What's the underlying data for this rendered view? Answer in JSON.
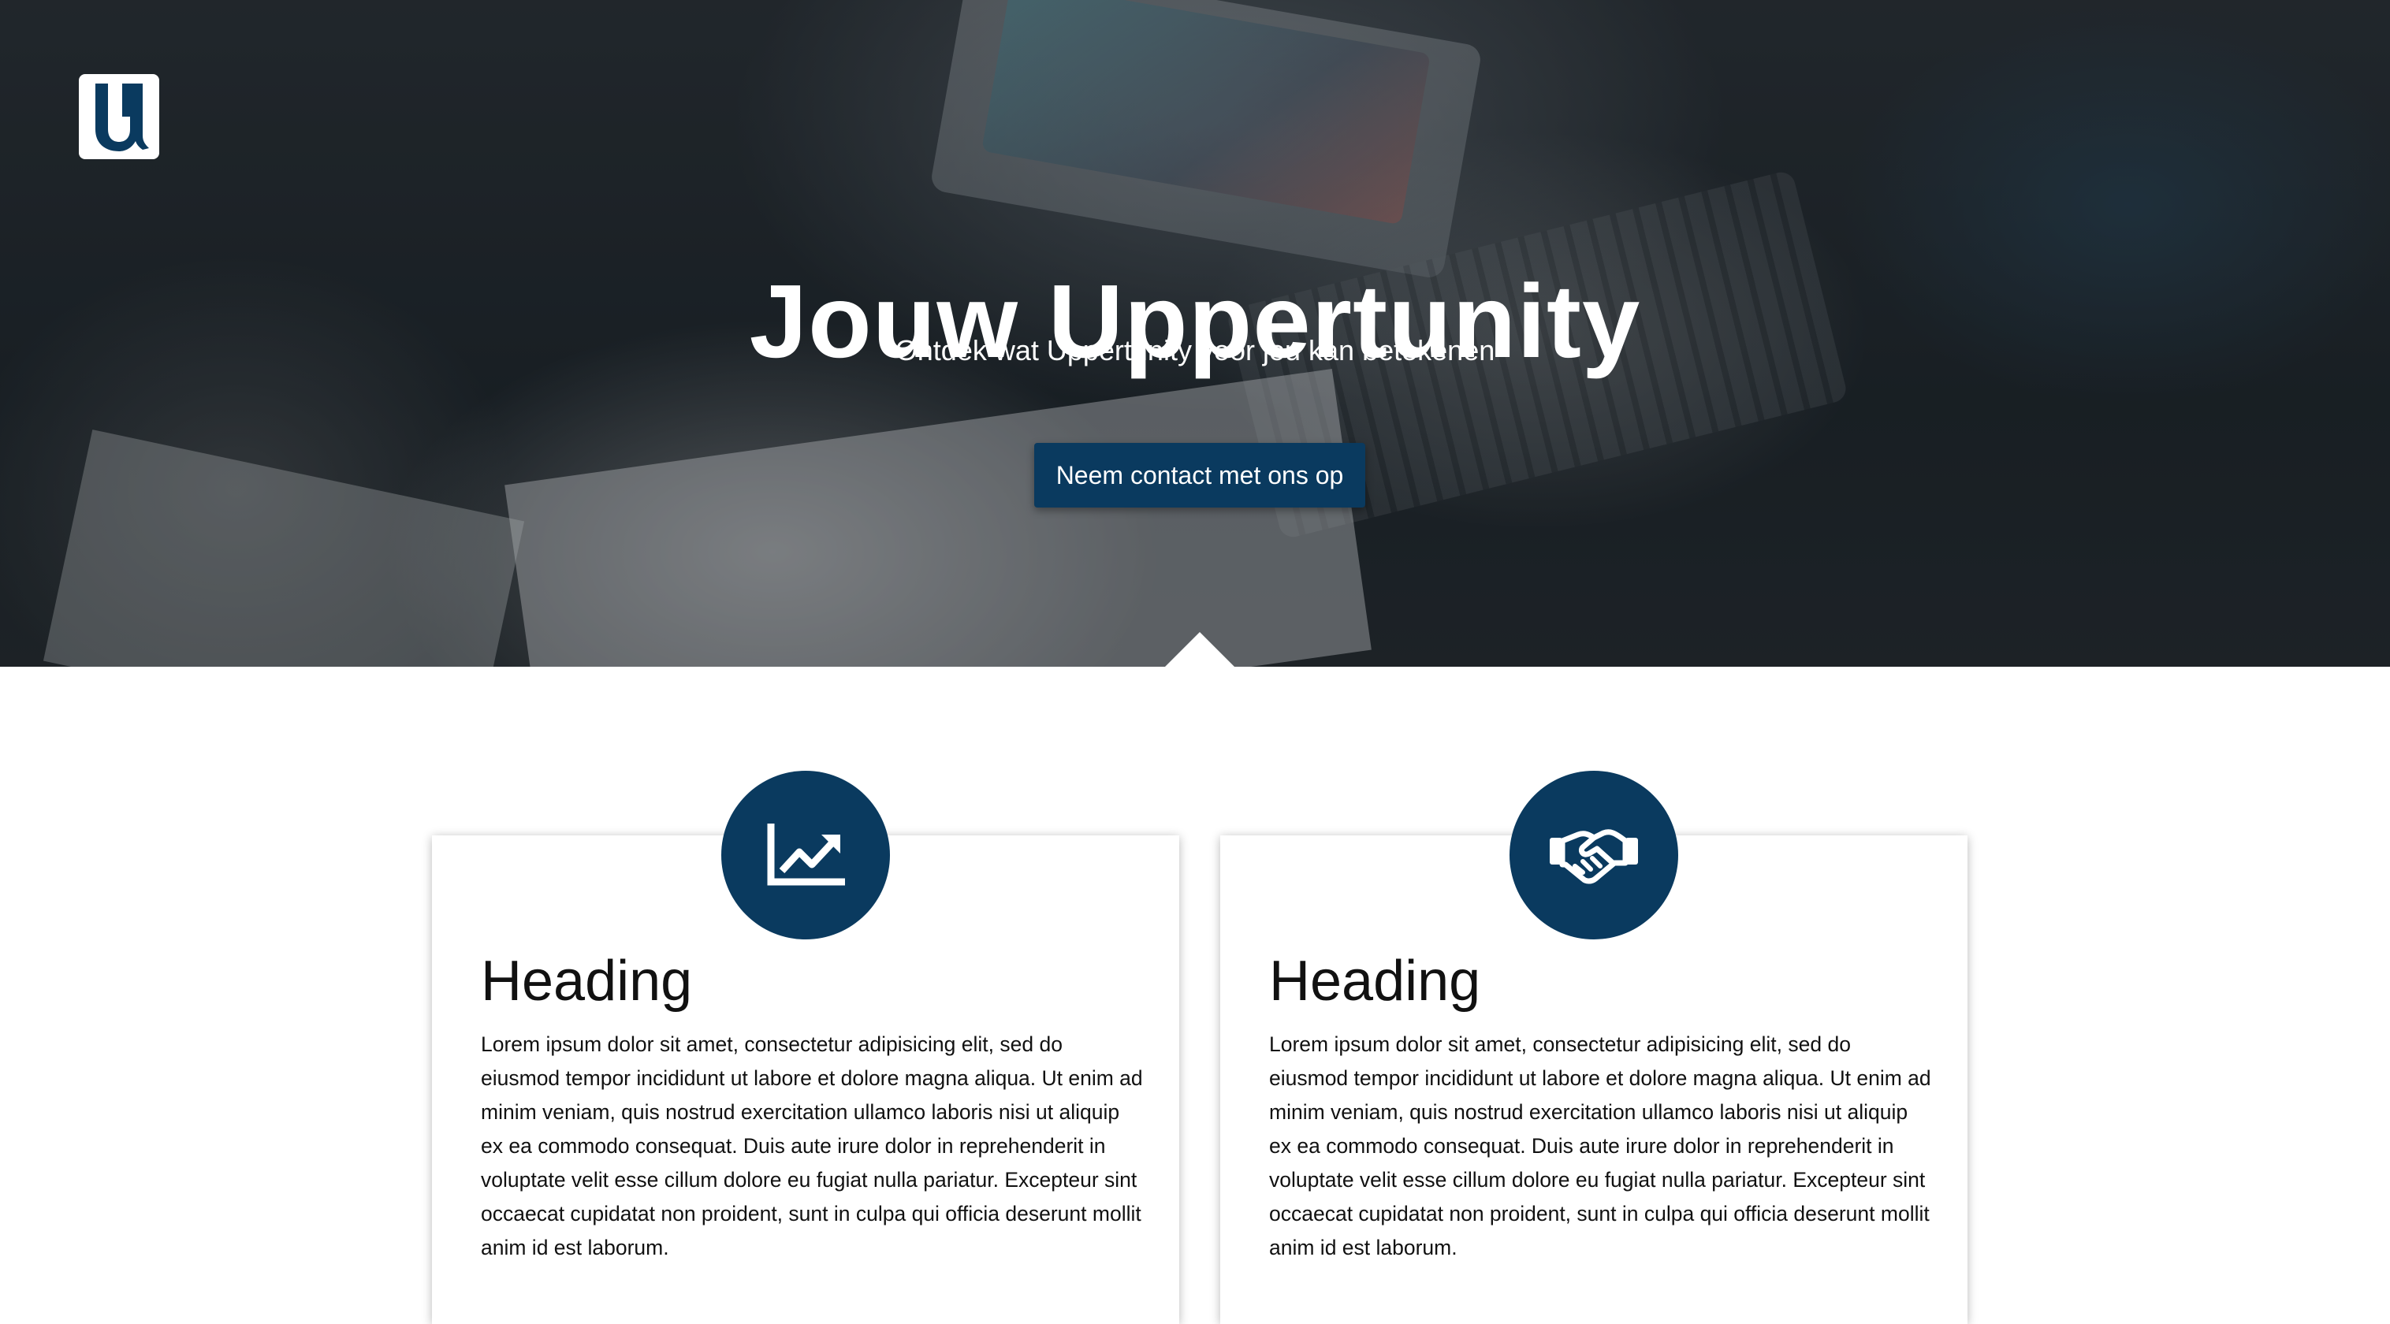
{
  "hero": {
    "title": "Jouw Uppertunity",
    "subtitle": "Ontdek wat Uppertunity voor jou kan betekenen",
    "cta_label": "Neem contact met ons op",
    "logo_letter": "U"
  },
  "colors": {
    "brand": "#0a3a5f",
    "text": "#111111",
    "background": "#ffffff"
  },
  "cards": [
    {
      "icon": "chart-line-up-icon",
      "heading": "Heading",
      "body": "Lorem ipsum dolor sit amet, consectetur adipisicing elit, sed do eiusmod tempor incididunt ut labore et dolore magna aliqua. Ut enim ad minim veniam, quis nostrud exercitation ullamco laboris nisi ut aliquip ex ea commodo consequat. Duis aute irure dolor in reprehenderit in voluptate velit esse cillum dolore eu fugiat nulla pariatur. Excepteur sint occaecat cupidatat non proident, sunt in culpa qui officia deserunt mollit anim id est laborum."
    },
    {
      "icon": "handshake-icon",
      "heading": "Heading",
      "body": "Lorem ipsum dolor sit amet, consectetur adipisicing elit, sed do eiusmod tempor incididunt ut labore et dolore magna aliqua. Ut enim ad minim veniam, quis nostrud exercitation ullamco laboris nisi ut aliquip ex ea commodo consequat. Duis aute irure dolor in reprehenderit in voluptate velit esse cillum dolore eu fugiat nulla pariatur. Excepteur sint occaecat cupidatat non proident, sunt in culpa qui officia deserunt mollit anim id est laborum."
    }
  ]
}
